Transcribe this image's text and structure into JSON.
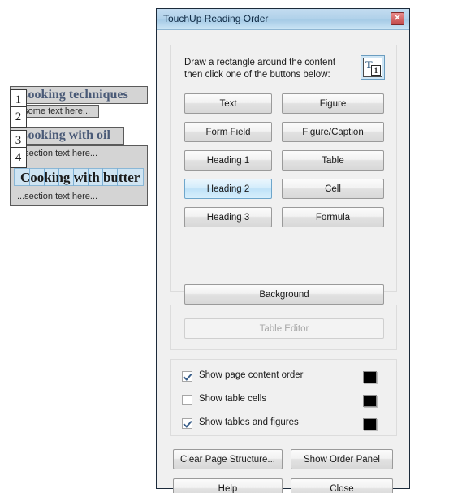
{
  "dialog": {
    "title": "TouchUp Reading Order",
    "close_icon": "close-icon",
    "instruction": "Draw a rectangle around the content\nthen click one of the buttons below:",
    "hint_icon": {
      "letter": "T",
      "number": "1",
      "name": "text-order-hint-icon"
    },
    "tag_buttons": [
      {
        "label": "Text",
        "state": "normal"
      },
      {
        "label": "Figure",
        "state": "normal"
      },
      {
        "label": "Form Field",
        "state": "normal"
      },
      {
        "label": "Figure/Caption",
        "state": "normal"
      },
      {
        "label": "Heading 1",
        "state": "normal"
      },
      {
        "label": "Table",
        "state": "normal"
      },
      {
        "label": "Heading 2",
        "state": "highlighted"
      },
      {
        "label": "Cell",
        "state": "normal"
      },
      {
        "label": "Heading 3",
        "state": "normal"
      },
      {
        "label": "Formula",
        "state": "normal"
      }
    ],
    "background_button": "Background",
    "table_editor_button": {
      "label": "Table Editor",
      "state": "disabled"
    },
    "options": [
      {
        "label": "Show page content order",
        "checked": true,
        "swatch_color": "#000000"
      },
      {
        "label": "Show table cells",
        "checked": false,
        "swatch_color": "#000000"
      },
      {
        "label": "Show tables and figures",
        "checked": true,
        "swatch_color": "#000000"
      }
    ],
    "actions": {
      "clear": "Clear Page Structure...",
      "order_panel": "Show Order Panel",
      "help": "Help",
      "close": "Close"
    }
  },
  "document": {
    "blocks": [
      {
        "order": "1",
        "type": "heading",
        "text": "Cooking techniques"
      },
      {
        "order": "2",
        "type": "text",
        "text": "...some text here..."
      },
      {
        "order": "3",
        "type": "heading",
        "text": "Cooking with oil"
      },
      {
        "order": "4",
        "type": "text",
        "text": "...section text here..."
      }
    ],
    "selected_block": {
      "text": "Cooking with butter",
      "highlight_color": "#cfe4f2"
    },
    "trailing_text": "...section text here..."
  }
}
